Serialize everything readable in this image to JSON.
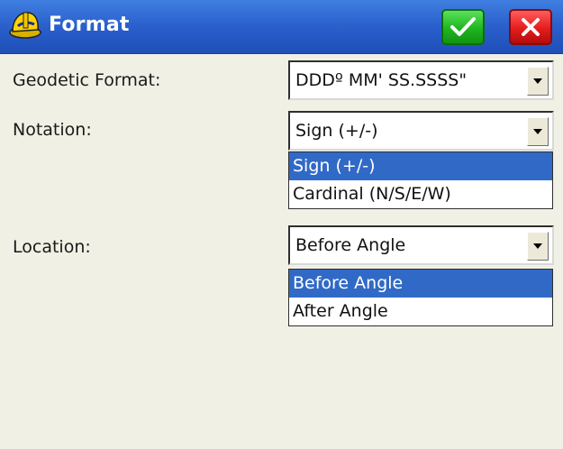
{
  "window": {
    "title": "Format",
    "ok_icon": "checkmark-icon",
    "close_icon": "close-icon",
    "app_icon": "hardhat-icon"
  },
  "fields": {
    "geodetic_format": {
      "label": "Geodetic Format:",
      "value": "DDDº MM' SS.SSSS\""
    },
    "notation": {
      "label": "Notation:",
      "value": "Sign (+/-)",
      "options": [
        "Sign (+/-)",
        "Cardinal (N/S/E/W)"
      ],
      "selected_index": 0
    },
    "location": {
      "label": "Location:",
      "value": "Before Angle",
      "options": [
        "Before Angle",
        "After Angle"
      ],
      "selected_index": 0
    }
  },
  "colors": {
    "titlebar": "#2a5fcc",
    "ok": "#1fb51f",
    "close": "#e51c1c",
    "selection": "#3169c6",
    "background": "#f0f0e4"
  }
}
